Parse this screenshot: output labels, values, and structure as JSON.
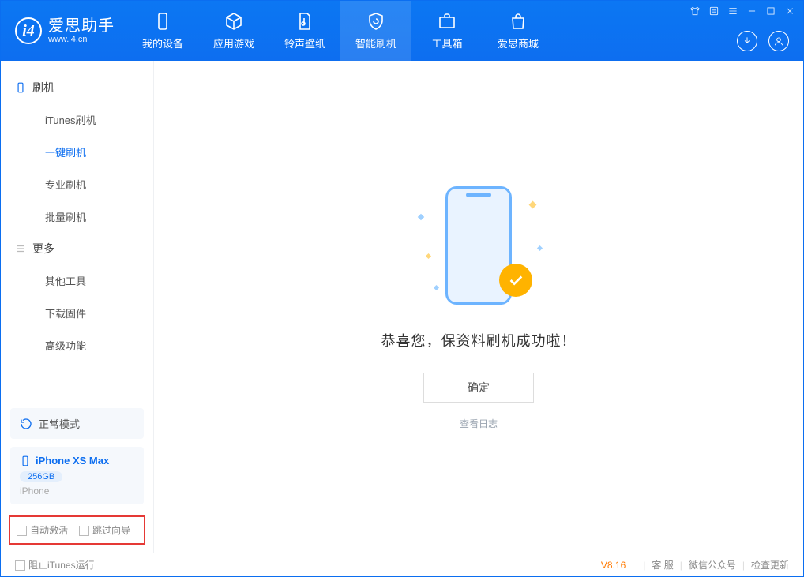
{
  "logo": {
    "cn": "爱思助手",
    "en": "www.i4.cn"
  },
  "nav": {
    "items": [
      {
        "label": "我的设备"
      },
      {
        "label": "应用游戏"
      },
      {
        "label": "铃声壁纸"
      },
      {
        "label": "智能刷机"
      },
      {
        "label": "工具箱"
      },
      {
        "label": "爱思商城"
      }
    ]
  },
  "sidebar": {
    "group1_title": "刷机",
    "group1_items": [
      {
        "label": "iTunes刷机"
      },
      {
        "label": "一键刷机"
      },
      {
        "label": "专业刷机"
      },
      {
        "label": "批量刷机"
      }
    ],
    "group2_title": "更多",
    "group2_items": [
      {
        "label": "其他工具"
      },
      {
        "label": "下载固件"
      },
      {
        "label": "高级功能"
      }
    ],
    "mode_label": "正常模式",
    "device": {
      "name": "iPhone XS Max",
      "capacity": "256GB",
      "type": "iPhone"
    },
    "check_auto_activate": "自动激活",
    "check_skip_guide": "跳过向导"
  },
  "main": {
    "success_text": "恭喜您，保资料刷机成功啦！",
    "ok_button": "确定",
    "log_link": "查看日志"
  },
  "footer": {
    "block_itunes": "阻止iTunes运行",
    "version": "V8.16",
    "link_service": "客 服",
    "link_wechat": "微信公众号",
    "link_update": "检查更新"
  }
}
